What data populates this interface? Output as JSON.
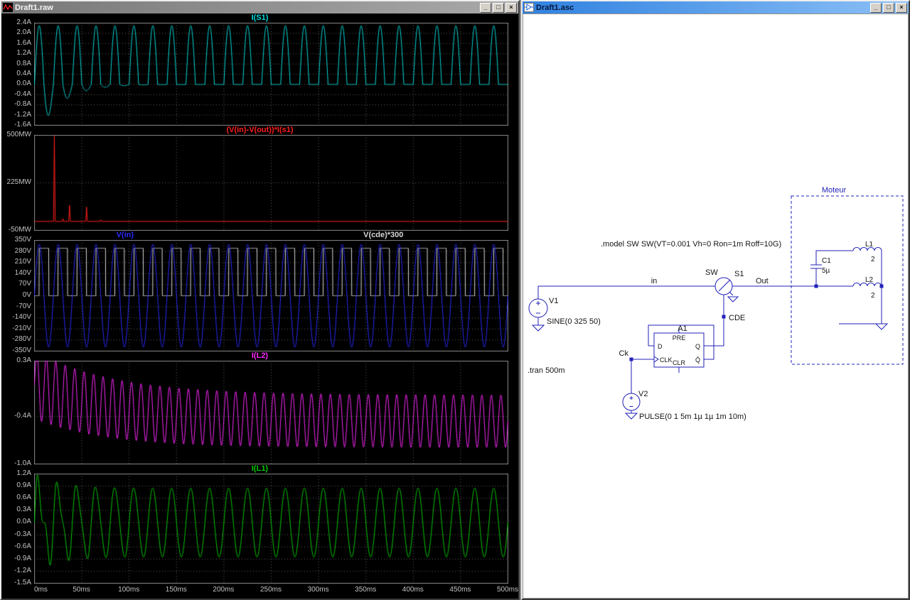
{
  "left_window": {
    "title": "Draft1.raw"
  },
  "right_window": {
    "title": "Draft1.asc"
  },
  "window_controls": {
    "minimize": "_",
    "maximize": "□",
    "close": "×"
  },
  "icons": {
    "left_titlebar": "waveform-icon",
    "right_titlebar": "schematic-icon"
  },
  "chart_data": {
    "type": "line",
    "background": "#000000",
    "grid_color": "#5f5f5f",
    "x_unit": "ms",
    "xlim_ms": [
      0,
      500
    ],
    "x_tick_step_ms": 50,
    "x_tick_labels": [
      "0ms",
      "50ms",
      "100ms",
      "150ms",
      "200ms",
      "250ms",
      "300ms",
      "350ms",
      "400ms",
      "450ms",
      "500ms"
    ],
    "panes": [
      {
        "ylim": [
          -1.6,
          2.4
        ],
        "y_ticks": [
          {
            "label": "2.4A",
            "v": 2.4
          },
          {
            "label": "2.0A",
            "v": 2.0
          },
          {
            "label": "1.6A",
            "v": 1.6
          },
          {
            "label": "1.2A",
            "v": 1.2
          },
          {
            "label": "0.8A",
            "v": 0.8
          },
          {
            "label": "0.4A",
            "v": 0.4
          },
          {
            "label": "0.0A",
            "v": 0.0
          },
          {
            "label": "-0.4A",
            "v": -0.4
          },
          {
            "label": "-0.8A",
            "v": -0.8
          },
          {
            "label": "-1.2A",
            "v": -1.2
          },
          {
            "label": "-1.6A",
            "v": -1.6
          }
        ],
        "traces": [
          {
            "label": "I(S1)",
            "color": "#00dcdc",
            "wave": {
              "kind": "rectified_sine_with_dips",
              "amp": 2.3,
              "freq_hz": 50,
              "dip_amp": 2.2,
              "dip_tau_s": 0.025
            }
          }
        ]
      },
      {
        "ylim": [
          -50,
          500
        ],
        "unit": "MW",
        "y_ticks": [
          {
            "label": "500MW",
            "v": 500
          },
          {
            "label": "225MW",
            "v": 225
          },
          {
            "label": "-50MW",
            "v": -50
          }
        ],
        "traces": [
          {
            "label": "(V(in)-V(out))*I(s1)",
            "color": "#ff1e1e",
            "wave": {
              "kind": "spikes",
              "baseline": 2,
              "half_width_ms": 0.9,
              "spikes": [
                {
                  "t_ms": 21,
                  "v": 497
                },
                {
                  "t_ms": 30,
                  "v": 18
                },
                {
                  "t_ms": 37,
                  "v": 95
                },
                {
                  "t_ms": 55,
                  "v": 85
                },
                {
                  "t_ms": 70,
                  "v": 12
                }
              ]
            }
          }
        ]
      },
      {
        "ylim": [
          -350,
          350
        ],
        "y_ticks": [
          {
            "label": "350V",
            "v": 350
          },
          {
            "label": "280V",
            "v": 280
          },
          {
            "label": "210V",
            "v": 210
          },
          {
            "label": "140V",
            "v": 140
          },
          {
            "label": "70V",
            "v": 70
          },
          {
            "label": "0V",
            "v": 0
          },
          {
            "label": "-70V",
            "v": -70
          },
          {
            "label": "-140V",
            "v": -140
          },
          {
            "label": "-210V",
            "v": -210
          },
          {
            "label": "-280V",
            "v": -280
          },
          {
            "label": "-350V",
            "v": -350
          }
        ],
        "traces": [
          {
            "label": "V(in)",
            "color": "#2a2aff",
            "wave": {
              "kind": "sine",
              "amp": 325,
              "freq_hz": 50
            }
          },
          {
            "label": "V(cde)*300",
            "color": "#d8d8d8",
            "wave": {
              "kind": "square",
              "low": 0,
              "high": 300,
              "delay_s": 0.005,
              "half_period_s": 0.01
            }
          }
        ]
      },
      {
        "ylim": [
          -1.0,
          0.3
        ],
        "y_ticks": [
          {
            "label": "0.3A",
            "v": 0.3
          },
          {
            "label": "-0.4A",
            "v": -0.4
          },
          {
            "label": "-1.0A",
            "v": -1.0
          }
        ],
        "traces": [
          {
            "label": "I(L2)",
            "color": "#ff28ff",
            "wave": {
              "kind": "damped_offset_sine",
              "offset": -0.46,
              "offset_tau_s": 0.08,
              "amp_steady": 0.33,
              "amp_extra": 0.1,
              "amp_tau_s": 0.1,
              "freq_hz": 100
            }
          }
        ]
      },
      {
        "ylim": [
          -1.5,
          1.2
        ],
        "y_ticks": [
          {
            "label": "1.2A",
            "v": 1.2
          },
          {
            "label": "0.9A",
            "v": 0.9
          },
          {
            "label": "0.6A",
            "v": 0.6
          },
          {
            "label": "0.3A",
            "v": 0.3
          },
          {
            "label": "0.0A",
            "v": 0.0
          },
          {
            "label": "-0.3A",
            "v": -0.3
          },
          {
            "label": "-0.6A",
            "v": -0.6
          },
          {
            "label": "-0.9A",
            "v": -0.9
          },
          {
            "label": "-1.2A",
            "v": -1.2
          },
          {
            "label": "-1.5A",
            "v": -1.5
          }
        ],
        "traces": [
          {
            "label": "I(L1)",
            "color": "#00cd00",
            "wave": {
              "kind": "sine_plus_transient",
              "amp": 0.85,
              "freq_hz": 50,
              "t_amp": 0.55,
              "t_freq_hz": 100,
              "t_tau_s": 0.04
            }
          }
        ]
      }
    ]
  },
  "schematic": {
    "wire_color": "#2121b8",
    "directives": {
      "model": ".model SW SW(VT=0.001 Vh=0 Ron=1m Roff=10G)",
      "tran": ".tran 500m"
    },
    "nets": {
      "in": "in",
      "out": "Out",
      "cde": "CDE",
      "ck": "Ck"
    },
    "v1": {
      "name": "V1",
      "value": "SINE(0 325 50)"
    },
    "v2": {
      "name": "V2",
      "value": "PULSE(0 1 5m 1µ 1µ 1m 10m)"
    },
    "s1": {
      "name": "S1",
      "model": "SW"
    },
    "a1": {
      "name": "A1",
      "pin_d": "D",
      "pin_clk": "CLK",
      "pin_pre": "PRE",
      "pin_clr": "CLR",
      "pin_q": "Q",
      "pin_qbar": "Q̄"
    },
    "moteur": {
      "label": "Moteur",
      "l1_name": "L1",
      "l1_value": "2",
      "l2_name": "L2",
      "l2_value": "2",
      "c1_name": "C1",
      "c1_value": "5µ"
    }
  }
}
